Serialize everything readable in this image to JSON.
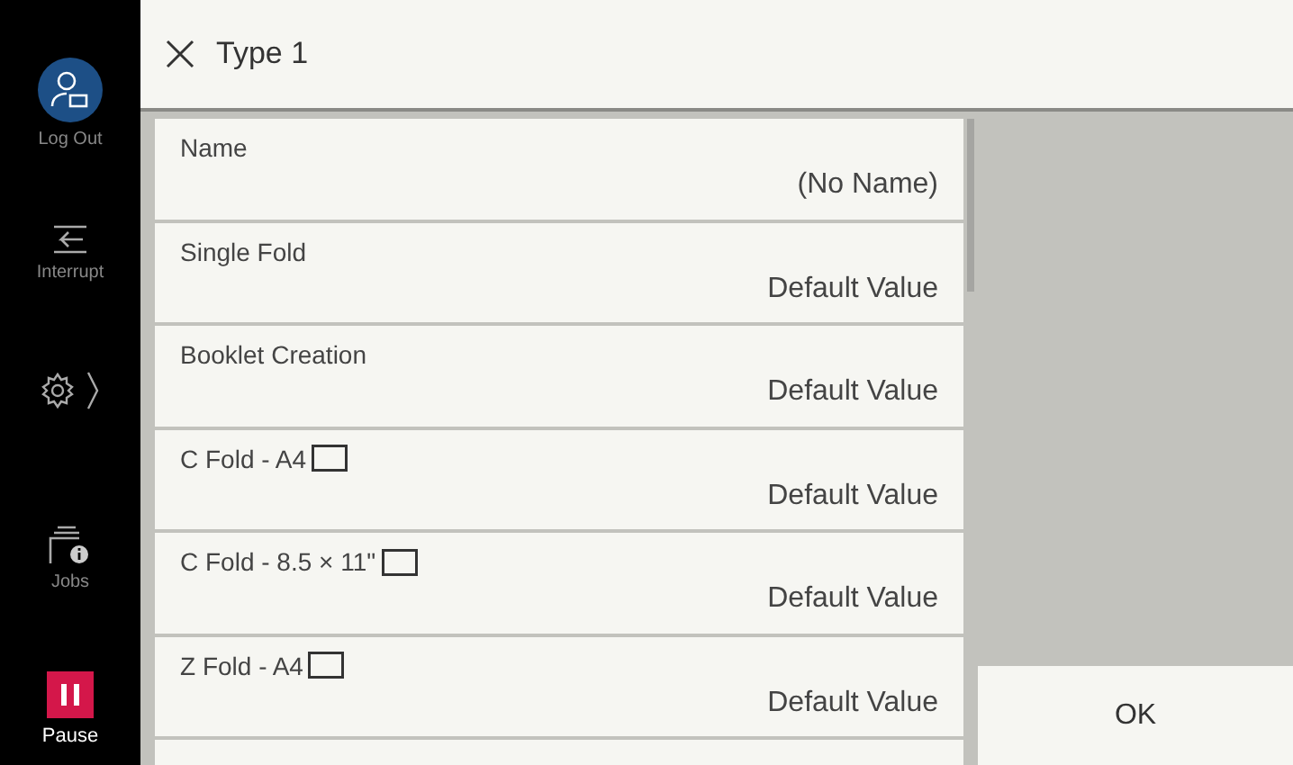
{
  "sidebar": {
    "items": [
      {
        "kind": "logout",
        "label": "Log Out"
      },
      {
        "kind": "interrupt",
        "label": "Interrupt"
      },
      {
        "kind": "settings"
      },
      {
        "kind": "jobs",
        "label": "Jobs"
      },
      {
        "kind": "pause",
        "label": "Pause"
      }
    ]
  },
  "header": {
    "title": "Type 1"
  },
  "rows": [
    {
      "label": "Name",
      "value": "(No Name)",
      "paper_icon": false
    },
    {
      "label": "Single Fold",
      "value": "Default Value",
      "paper_icon": false
    },
    {
      "label": "Booklet Creation",
      "value": "Default Value",
      "paper_icon": false
    },
    {
      "label": "C Fold - A4",
      "value": "Default Value",
      "paper_icon": true
    },
    {
      "label": "C Fold - 8.5 × 11\"",
      "value": "Default Value",
      "paper_icon": true
    },
    {
      "label": "Z Fold - A4",
      "value": "Default Value",
      "paper_icon": true
    }
  ],
  "ok_button": {
    "label": "OK"
  }
}
